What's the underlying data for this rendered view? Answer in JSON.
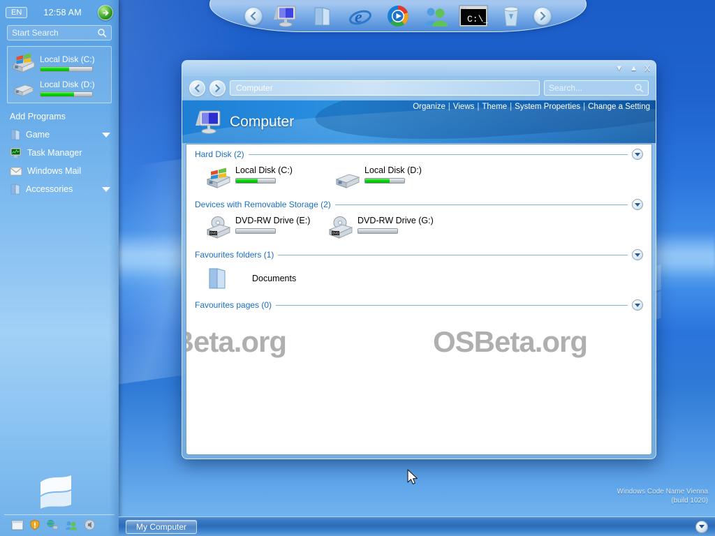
{
  "sidebar": {
    "language": "EN",
    "clock": "12:58 AM",
    "power_icon": "power-arrow-icon",
    "search": {
      "placeholder": "Start Search",
      "icon": "search-icon"
    },
    "drives": [
      {
        "name": "Local Disk (C:)",
        "icon": "windows-drive-icon",
        "used_percent": 55
      },
      {
        "name": "Local Disk (D:)",
        "icon": "hard-drive-icon",
        "used_percent": 65
      }
    ],
    "programs_title": "Add Programs",
    "items": [
      {
        "label": "Game",
        "icon": "folder-games-icon",
        "has_submenu": true
      },
      {
        "label": "Task Manager",
        "icon": "task-manager-icon",
        "has_submenu": false
      },
      {
        "label": "Windows Mail",
        "icon": "mail-icon",
        "has_submenu": false
      },
      {
        "label": "Accessories",
        "icon": "folder-accessories-icon",
        "has_submenu": true
      }
    ],
    "logo_icon": "windows-flag-logo",
    "tray": [
      {
        "icon": "show-desktop-icon"
      },
      {
        "icon": "security-shield-icon"
      },
      {
        "icon": "network-globe-icon"
      },
      {
        "icon": "users-icon"
      },
      {
        "icon": "volume-speaker-icon"
      }
    ]
  },
  "dock": {
    "prev_icon": "dock-back-arrow-icon",
    "next_icon": "dock-forward-arrow-icon",
    "items": [
      {
        "icon": "my-computer-icon",
        "label": "My Computer"
      },
      {
        "icon": "folder-icon",
        "label": "Documents"
      },
      {
        "icon": "internet-explorer-icon",
        "label": "Internet Explorer"
      },
      {
        "icon": "media-player-icon",
        "label": "Windows Media Player"
      },
      {
        "icon": "users-contacts-icon",
        "label": "Contacts"
      },
      {
        "icon": "command-prompt-icon",
        "label": "C:\\_"
      },
      {
        "icon": "recycle-bin-icon",
        "label": "Recycle Bin"
      }
    ]
  },
  "window": {
    "controls": {
      "minimize": "▼",
      "maximize": "▲",
      "close": "X"
    },
    "nav": {
      "back_icon": "back-arrow-icon",
      "forward_icon": "forward-arrow-icon"
    },
    "address": {
      "value": "Computer"
    },
    "search": {
      "placeholder": "Search...",
      "icon": "search-icon"
    },
    "banner": {
      "title": "Computer",
      "icon": "computer-monitor-icon",
      "links": [
        "Organize",
        "Views",
        "Theme",
        "System Properties",
        "Change a Setting"
      ],
      "separator": "|"
    },
    "groups": [
      {
        "title": "Hard Disk (2)",
        "items": [
          {
            "name": "Local Disk (C:)",
            "icon": "windows-drive-icon",
            "used_percent": 55,
            "has_bar": true
          },
          {
            "name": "Local Disk (D:)",
            "icon": "hard-drive-icon",
            "used_percent": 62,
            "has_bar": true
          }
        ]
      },
      {
        "title": "Devices with Removable Storage (2)",
        "items": [
          {
            "name": "DVD-RW Drive (E:)",
            "icon": "dvd-drive-icon",
            "used_percent": 0,
            "has_bar": true
          },
          {
            "name": "DVD-RW Drive (G:)",
            "icon": "dvd-drive-icon",
            "used_percent": 0,
            "has_bar": true
          }
        ]
      },
      {
        "title": "Favourites folders (1)",
        "items": [
          {
            "name": "Documents",
            "icon": "folder-icon",
            "used_percent": 0,
            "has_bar": false
          }
        ]
      },
      {
        "title": "Favourites pages (0)",
        "items": []
      }
    ],
    "watermarks": [
      "OSBeta.org",
      "OSBeta.org"
    ]
  },
  "taskbar": {
    "buttons": [
      {
        "label": "My Computer"
      }
    ],
    "overflow_icon": "chevron-down-icon"
  },
  "desktop": {
    "build_watermark_line1": "Windows Code Name Vienna",
    "build_watermark_line2": "(build 1020)"
  },
  "colors": {
    "accent_blue": "#1a6fc4",
    "banner_blue": "#1e7fd4",
    "bar_green": "#12d312",
    "sidebar_blue": "#81bdf0"
  }
}
